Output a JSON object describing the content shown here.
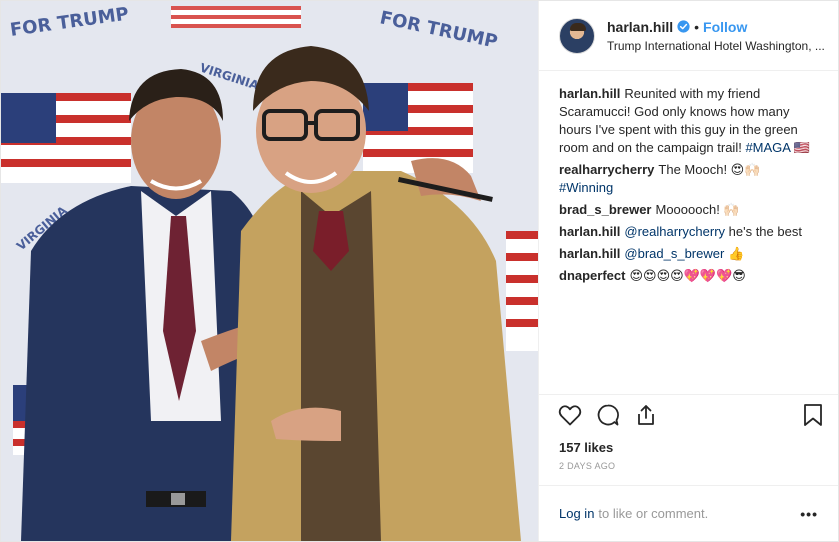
{
  "post": {
    "username": "harlan.hill",
    "follow_label": "Follow",
    "separator": "•",
    "location": "Trump International Hotel Washington, ..."
  },
  "photo": {
    "backdrop_text_left": "FOR TRUMP",
    "backdrop_text_right": "FOR TRUMP",
    "backdrop_text_virginia_left": "VIRGINIA",
    "backdrop_text_virginia_mid": "VIRGINIA"
  },
  "comments": [
    {
      "user": "harlan.hill",
      "text": "Reunited with my friend Scaramucci! God only knows how many hours I've spent with this guy in the green room and on the campaign trail! ",
      "tag": "#MAGA",
      "emoji": "🇺🇸"
    },
    {
      "user": "realharrycherry",
      "text": "The Mooch! 😍🙌🏻",
      "tag": "#Winning",
      "emoji": ""
    },
    {
      "user": "brad_s_brewer",
      "text": "Moooooch! 🙌🏻",
      "tag": "",
      "emoji": ""
    },
    {
      "user": "harlan.hill",
      "mention": "@realharrycherry",
      "text": " he's the best"
    },
    {
      "user": "harlan.hill",
      "mention": "@brad_s_brewer",
      "text": " 👍"
    },
    {
      "user": "dnaperfect",
      "text": "😍😍😍😍💖💖💖😎"
    }
  ],
  "actions": {
    "icons": [
      "heart-icon",
      "comment-icon",
      "share-icon",
      "bookmark-icon"
    ]
  },
  "likes": "157 likes",
  "time_ago": "2 DAYS AGO",
  "login": {
    "link": "Log in",
    "text": "to like or comment.",
    "more": "•••"
  },
  "colors": {
    "link": "#003569",
    "follow": "#3897f0",
    "verified": "#3897f0",
    "muted": "#999999"
  }
}
